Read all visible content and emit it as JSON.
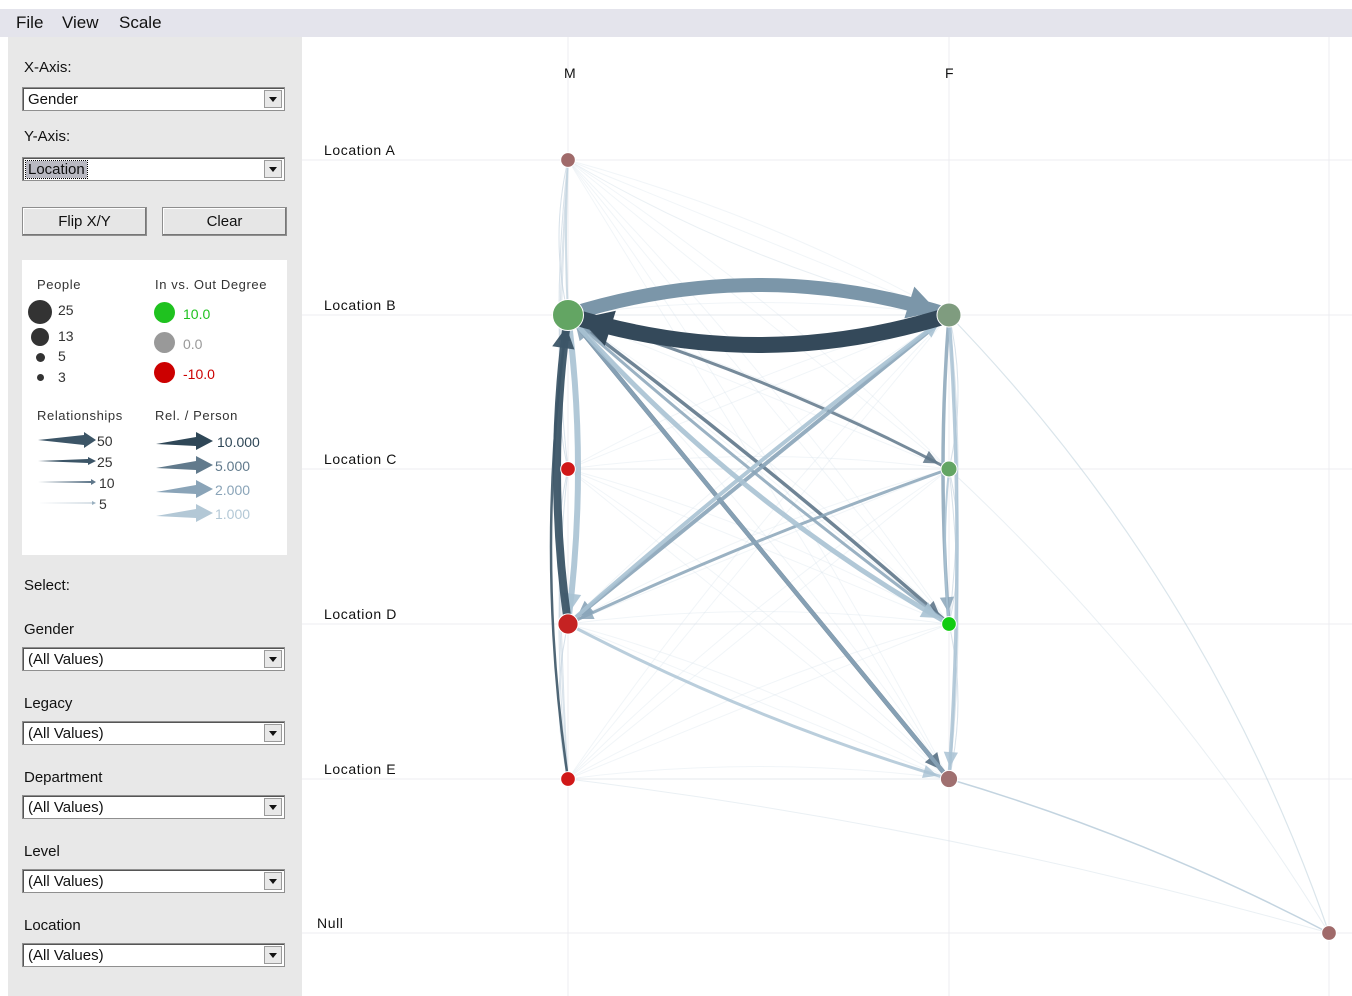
{
  "menu": [
    "File",
    "View",
    "Scale"
  ],
  "x_axis": {
    "label": "X-Axis:",
    "value": "Gender"
  },
  "y_axis": {
    "label": "Y-Axis:",
    "value": "Location"
  },
  "buttons": {
    "flip": "Flip X/Y",
    "clear": "Clear"
  },
  "legend": {
    "people_title": "People",
    "people_sizes": [
      "25",
      "13",
      "5",
      "3"
    ],
    "degree_title": "In vs. Out Degree",
    "degree_values": [
      "10.0",
      "0.0",
      "-10.0"
    ],
    "degree_colors": [
      "#1fc21f",
      "#999999",
      "#cc0000"
    ],
    "rel_title": "Relationships",
    "rel_values": [
      "50",
      "25",
      "10",
      "5"
    ],
    "rel_person_title": "Rel. / Person",
    "rel_person_values": [
      "10.000",
      "5.000",
      "2.000",
      "1.000"
    ]
  },
  "select_title": "Select:",
  "filters": [
    {
      "label": "Gender",
      "value": "(All Values)"
    },
    {
      "label": "Legacy",
      "value": "(All Values)"
    },
    {
      "label": "Department",
      "value": "(All Values)"
    },
    {
      "label": "Level",
      "value": "(All Values)"
    },
    {
      "label": "Location",
      "value": "(All Values)"
    }
  ],
  "graph": {
    "columns": [
      "M",
      "F"
    ],
    "rows": [
      "Location A",
      "Location B",
      "Location C",
      "Location D",
      "Location E",
      "Null"
    ],
    "nodes": [
      {
        "col": "M",
        "row": "Location A",
        "people": 3,
        "degree": -3,
        "color": "#a06a6a"
      },
      {
        "col": "M",
        "row": "Location B",
        "people": 25,
        "degree": 5,
        "color": "#63a563"
      },
      {
        "col": "M",
        "row": "Location C",
        "people": 3,
        "degree": -10,
        "color": "#d01818"
      },
      {
        "col": "M",
        "row": "Location D",
        "people": 8,
        "degree": -9,
        "color": "#c52222"
      },
      {
        "col": "M",
        "row": "Location E",
        "people": 3,
        "degree": -10,
        "color": "#d01818"
      },
      {
        "col": "F",
        "row": "Location B",
        "people": 13,
        "degree": 1,
        "color": "#7f9c7f"
      },
      {
        "col": "F",
        "row": "Location C",
        "people": 4,
        "degree": 4,
        "color": "#63a563"
      },
      {
        "col": "F",
        "row": "Location D",
        "people": 3,
        "degree": 10,
        "color": "#11cc11"
      },
      {
        "col": "F",
        "row": "Location E",
        "people": 5,
        "degree": -2,
        "color": "#a07070"
      },
      {
        "col": "Null",
        "row": "Null",
        "people": 3,
        "degree": -3,
        "color": "#a06a6a"
      }
    ]
  }
}
